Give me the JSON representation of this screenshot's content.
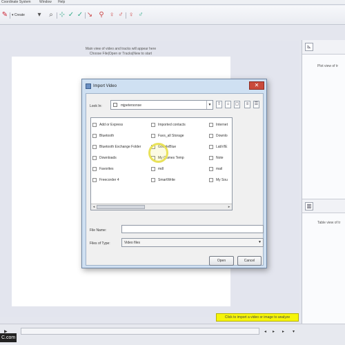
{
  "menubar": {
    "items": [
      "Coordinate System",
      "Window",
      "Help"
    ]
  },
  "toolbar": {
    "create_label": "Create"
  },
  "main": {
    "message_line1": "Main view of video and tracks will appear here",
    "message_line2": "Choose File|Open or Tracks|New to start"
  },
  "right_panel": {
    "top_message": "Plot view of tr",
    "bottom_message": "Table view of tr"
  },
  "dialog": {
    "title": "Import Video",
    "close_symbol": "✕",
    "look_in_label": "Look In:",
    "look_in_value": "mjpetersonse",
    "file_name_label": "File Name:",
    "file_name_value": "",
    "file_type_label": "Files of Type:",
    "file_type_value": "Video files",
    "open_label": "Open",
    "cancel_label": "Cancel",
    "files": [
      "Add or Express",
      "Bluetooth",
      "Bluetooth Exchange Folder",
      "Downloads",
      "Favorites",
      "Freecorder 4",
      "Imported contacts",
      "Favs_all Storage",
      "GoogleBlue",
      "My Games Temp",
      "mdl",
      "SmartWrite",
      "Internet",
      "Downlo",
      "LabVIE",
      "Note",
      "mail",
      "My Sou"
    ]
  },
  "bottom": {
    "hint": "Click to import a video or image to analyze",
    "watermark": "C.com"
  }
}
